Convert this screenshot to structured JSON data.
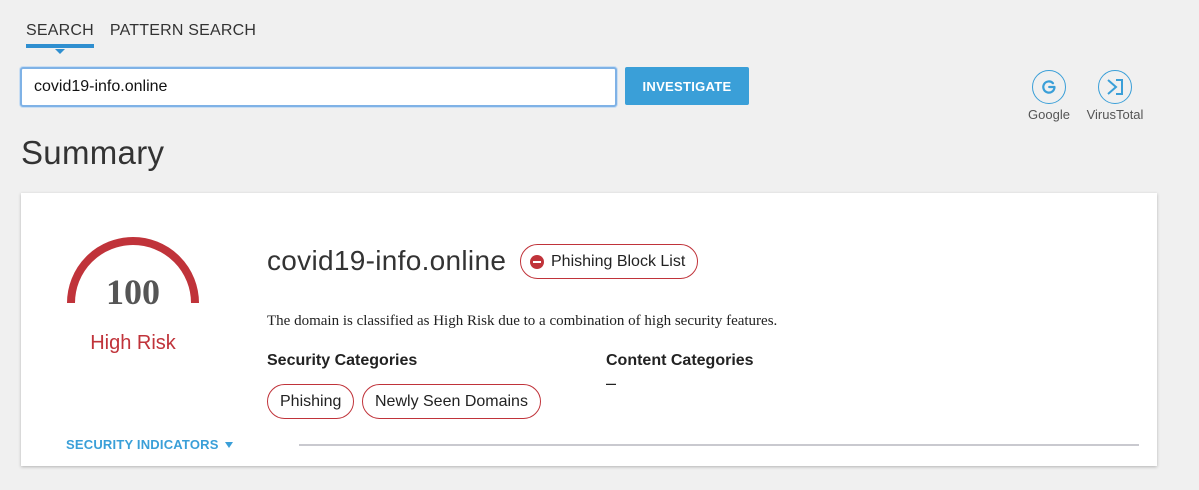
{
  "tabs": [
    {
      "label": "SEARCH",
      "active": true
    },
    {
      "label": "PATTERN SEARCH",
      "active": false
    }
  ],
  "search": {
    "value": "covid19-info.online",
    "button_label": "INVESTIGATE"
  },
  "external_links": [
    {
      "label": "Google",
      "icon": "google-icon",
      "glyph": "G"
    },
    {
      "label": "VirusTotal",
      "icon": "virustotal-icon",
      "glyph": "Σ"
    }
  ],
  "summary": {
    "title": "Summary",
    "score": "100",
    "risk_label": "High Risk",
    "domain": "covid19-info.online",
    "block_list": "Phishing Block List",
    "description": "The domain is classified as High Risk due to a combination of high security features.",
    "security_categories_heading": "Security Categories",
    "security_categories": [
      "Phishing",
      "Newly Seen Domains"
    ],
    "content_categories_heading": "Content Categories",
    "content_categories_value": "–",
    "security_indicators_label": "SECURITY INDICATORS"
  },
  "colors": {
    "accent": "#3a9fd8",
    "risk": "#c0333a",
    "background": "#f0f0f0"
  }
}
